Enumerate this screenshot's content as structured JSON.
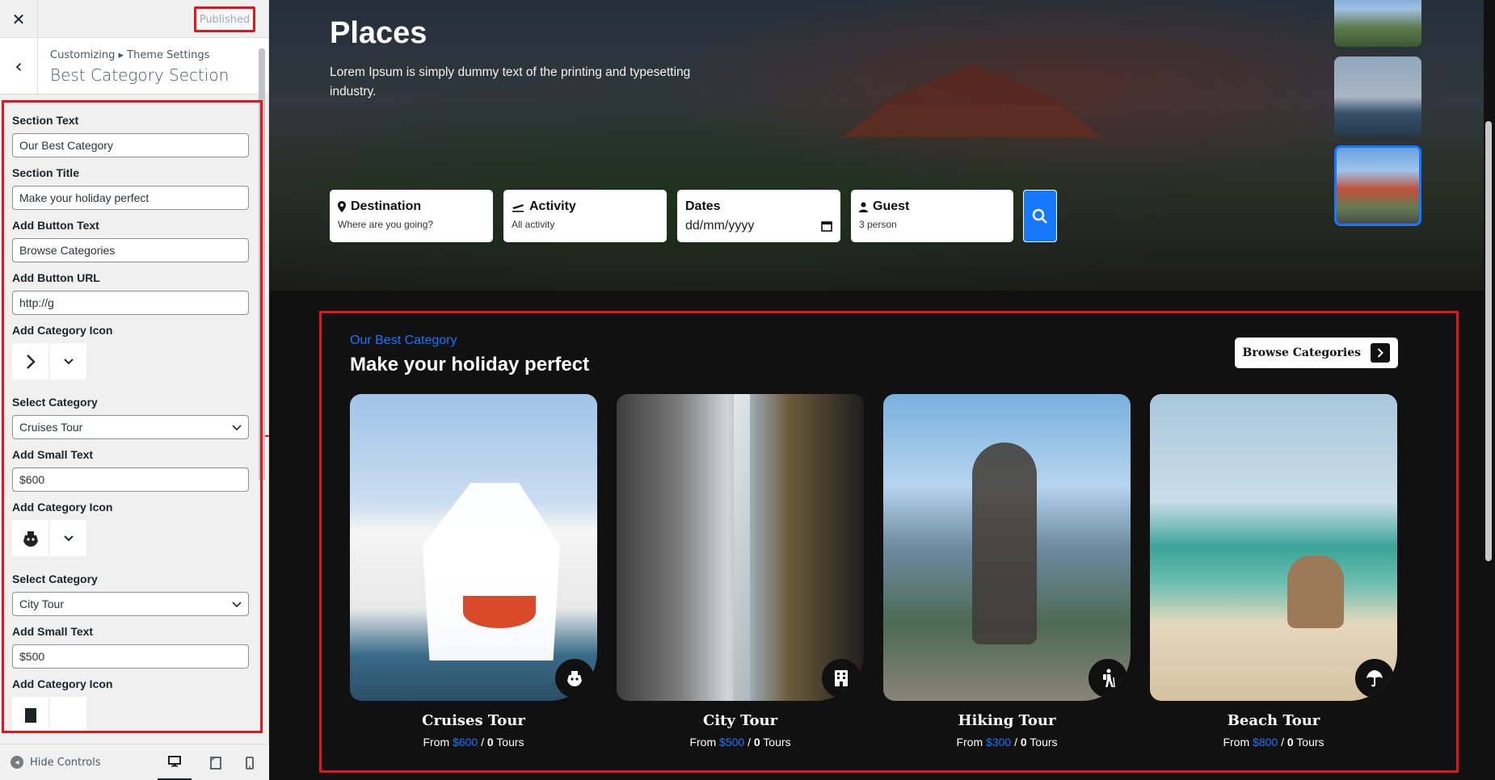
{
  "customizer": {
    "close_label": "✕",
    "published_label": "Published",
    "back_label": "‹",
    "breadcrumb": "Customizing ▸ Theme Settings",
    "section_title": "Best Category Section",
    "fields": {
      "section_text_label": "Section Text",
      "section_text_value": "Our Best Category",
      "section_title_label": "Section Title",
      "section_title_value": "Make your holiday perfect",
      "button_text_label": "Add Button Text",
      "button_text_value": "Browse Categories",
      "button_url_label": "Add Button URL",
      "button_url_value": "http://g",
      "category_icon_label_1": "Add Category Icon",
      "select_category_label_1": "Select Category",
      "select_category_value_1": "Cruises Tour",
      "small_text_label_1": "Add Small Text",
      "small_text_value_1": "$600",
      "category_icon_label_2": "Add Category Icon",
      "select_category_label_2": "Select Category",
      "select_category_value_2": "City Tour",
      "small_text_label_2": "Add Small Text",
      "small_text_value_2": "$500",
      "category_icon_label_3": "Add Category Icon"
    },
    "hide_controls_label": "Hide Controls",
    "devices": [
      "desktop",
      "tablet",
      "mobile"
    ]
  },
  "hero": {
    "title": "Places",
    "subtitle": "Lorem Ipsum is simply dummy text of the printing and typesetting industry.",
    "search": {
      "destination_label": "Destination",
      "destination_placeholder": "Where are you going?",
      "activity_label": "Activity",
      "activity_placeholder": "All activity",
      "dates_label": "Dates",
      "dates_placeholder": "dd/mm/yyyy",
      "guest_label": "Guest",
      "guest_value": "3 person"
    }
  },
  "category_section": {
    "small_text": "Our Best Category",
    "title": "Make your holiday perfect",
    "button_label": "Browse Categories",
    "cards": [
      {
        "title": "Cruises Tour",
        "from": "From",
        "price": "$600",
        "sep": "/",
        "count": "0",
        "tours": "Tours",
        "icon": "ship-icon"
      },
      {
        "title": "City Tour",
        "from": "From",
        "price": "$500",
        "sep": "/",
        "count": "0",
        "tours": "Tours",
        "icon": "building-icon"
      },
      {
        "title": "Hiking Tour",
        "from": "From",
        "price": "$300",
        "sep": "/",
        "count": "0",
        "tours": "Tours",
        "icon": "hiking-icon"
      },
      {
        "title": "Beach Tour",
        "from": "From",
        "price": "$800",
        "sep": "/",
        "count": "0",
        "tours": "Tours",
        "icon": "umbrella-icon"
      }
    ]
  },
  "colors": {
    "accent": "#1677ff",
    "highlight_border": "#e0161e",
    "background": "#111111"
  }
}
